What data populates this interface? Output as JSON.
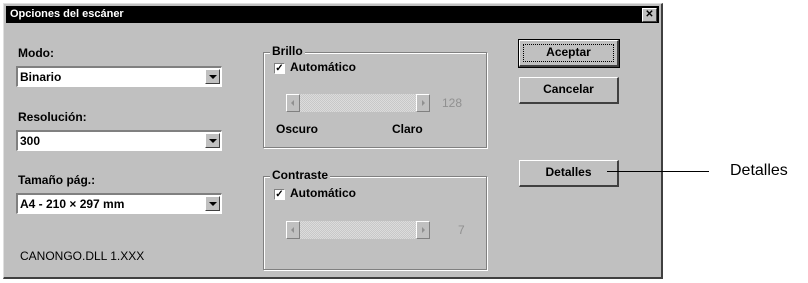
{
  "window": {
    "title": "Opciones del escáner",
    "close_label": "✕"
  },
  "left": {
    "mode_label": "Modo:",
    "mode_value": "Binario",
    "resolution_label": "Resolución:",
    "resolution_value": "300",
    "page_size_label": "Tamaño pág.:",
    "page_size_value": "A4 - 210 × 297 mm",
    "version": "CANONGO.DLL 1.XXX"
  },
  "brightness": {
    "group_label": "Brillo",
    "auto_label": "Automático",
    "auto_checked": true,
    "value": "128",
    "min_label": "Oscuro",
    "max_label": "Claro"
  },
  "contrast": {
    "group_label": "Contraste",
    "auto_label": "Automático",
    "auto_checked": true,
    "value": "7"
  },
  "buttons": {
    "accept": "Aceptar",
    "cancel": "Cancelar",
    "details": "Detalles"
  },
  "callout": {
    "text": "Detalles"
  }
}
